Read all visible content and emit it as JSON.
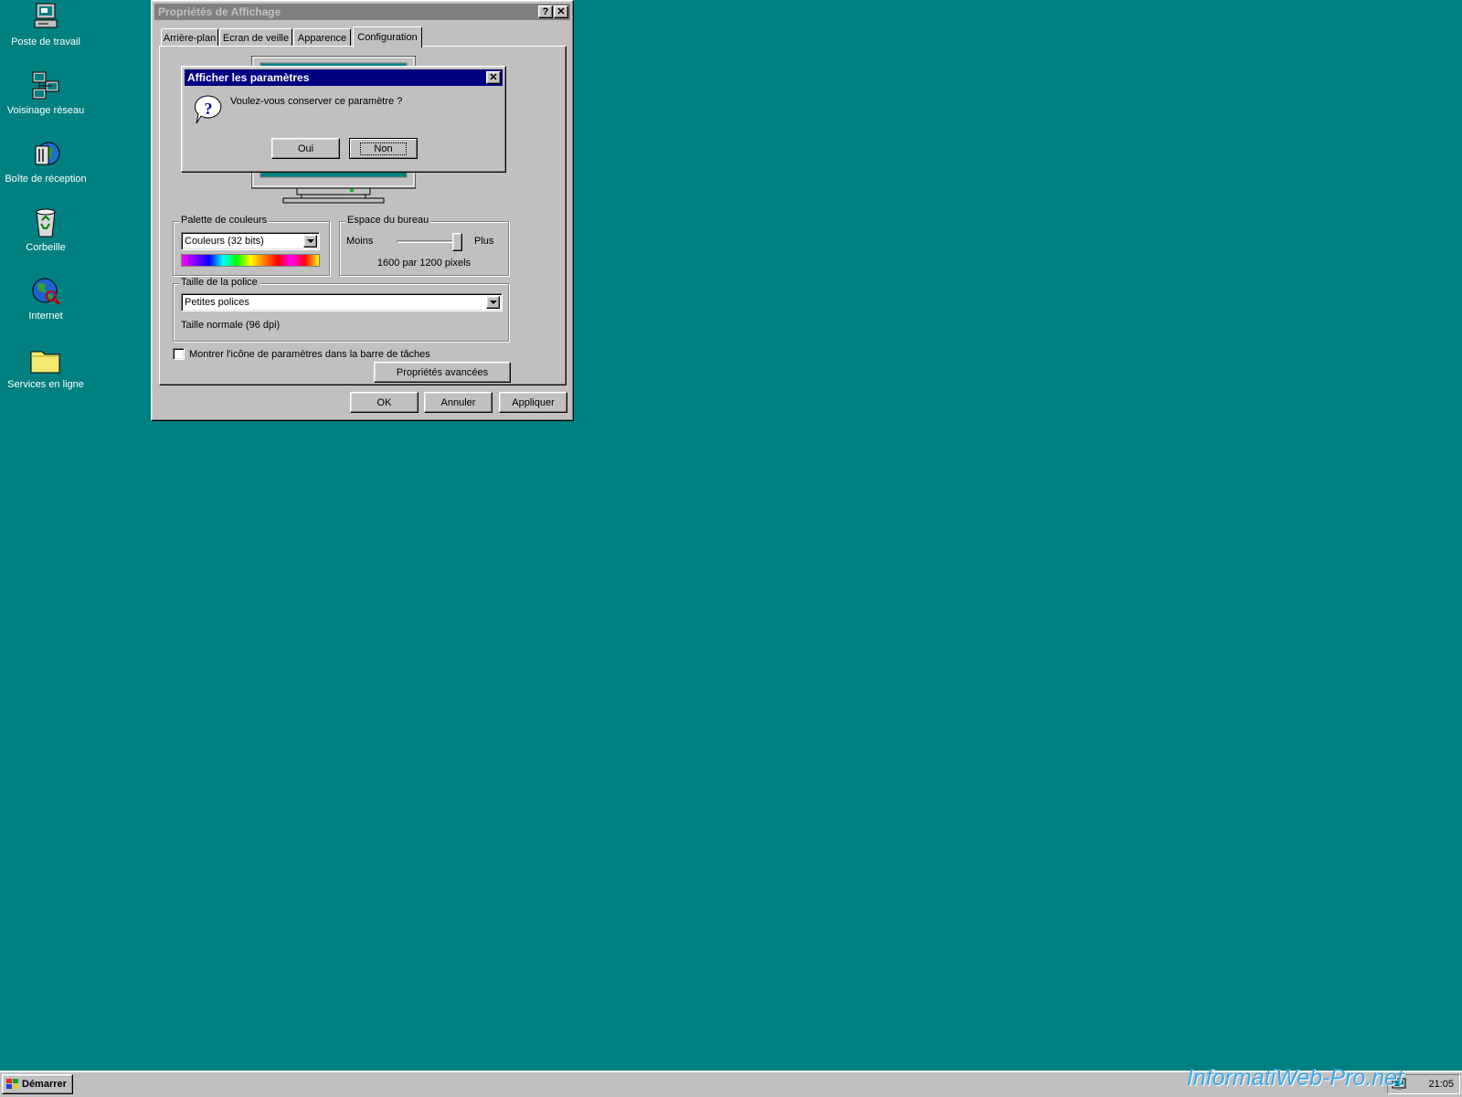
{
  "desktop": {
    "icons": [
      {
        "label": "Poste de travail",
        "icon": "my-computer-icon"
      },
      {
        "label": "Voisinage réseau",
        "icon": "network-neighborhood-icon"
      },
      {
        "label": "Boîte de réception",
        "icon": "inbox-icon"
      },
      {
        "label": "Corbeille",
        "icon": "recycle-bin-icon"
      },
      {
        "label": "Internet",
        "icon": "internet-icon"
      },
      {
        "label": "Services en ligne",
        "icon": "folder-icon"
      }
    ]
  },
  "window": {
    "title": "Propriétés de Affichage",
    "help_btn": "?",
    "close_btn": "✕",
    "tabs": [
      {
        "label": "Arrière-plan"
      },
      {
        "label": "Ecran de veille"
      },
      {
        "label": "Apparence"
      },
      {
        "label": "Configuration",
        "active": true
      }
    ],
    "color_palette": {
      "legend": "Palette de couleurs",
      "value": "Couleurs (32 bits)"
    },
    "desktop_area": {
      "legend": "Espace du bureau",
      "less": "Moins",
      "more": "Plus",
      "resolution": "1600 par 1200 pixels",
      "slider_level": 1.0
    },
    "font_size": {
      "legend": "Taille de la police",
      "value": "Petites polices",
      "info": "Taille normale (96 dpi)"
    },
    "tray_checkbox": {
      "label": "Montrer l'icône de paramètres dans la barre de tâches",
      "checked": false
    },
    "advanced_btn": "Propriétés avancées",
    "ok_btn": "OK",
    "cancel_btn": "Annuler",
    "apply_btn": "Appliquer"
  },
  "dialog": {
    "title": "Afficher les paramètres",
    "close_btn": "✕",
    "message": "Voulez-vous conserver ce paramètre ?",
    "yes_btn": "Oui",
    "no_btn": "Non"
  },
  "taskbar": {
    "start_label": "Démarrer",
    "clock": "21:05"
  },
  "watermark": "InformatiWeb-Pro.net",
  "colors": {
    "desktop": "#008080",
    "face": "#c0c0c0",
    "active_title": "#000080",
    "inactive_title": "#808080"
  }
}
